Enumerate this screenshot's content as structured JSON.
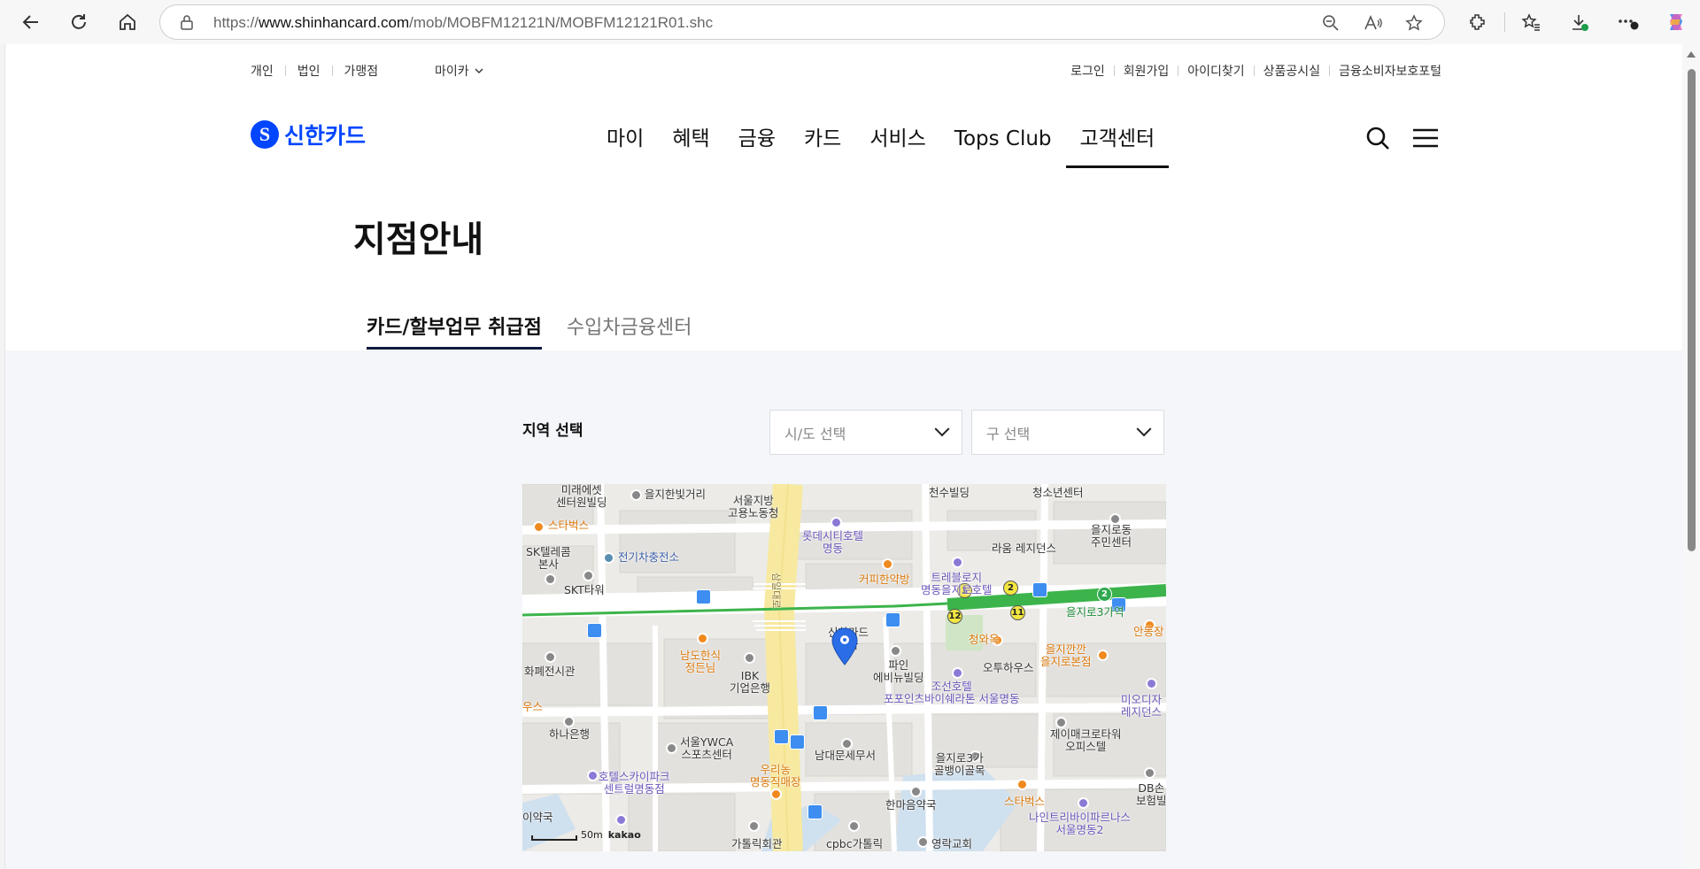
{
  "browser": {
    "url_prefix": "https://",
    "url_host": "www.shinhancard.com",
    "url_path": "/mob/MOBFM12121N/MOBFM12121R01.shc"
  },
  "util_nav": {
    "left": [
      "개인",
      "법인",
      "가맹점"
    ],
    "mycar": "마이카",
    "right": [
      "로그인",
      "회원가입",
      "아이디찾기",
      "상품공시실",
      "금융소비자보호포털"
    ]
  },
  "header": {
    "logo_mark": "S",
    "logo_text": "신한카드",
    "gnb": [
      "마이",
      "혜택",
      "금융",
      "카드",
      "서비스",
      "Tops Club",
      "고객센터"
    ]
  },
  "page": {
    "title": "지점안내",
    "tabs": [
      "카드/할부업무 취급점",
      "수입차금융센터"
    ]
  },
  "filter": {
    "label": "지역 선택",
    "city_placeholder": "시/도 선택",
    "district_placeholder": "구 선택"
  },
  "map": {
    "labels": {
      "l1": "미래에셋\n센터원빌딩",
      "l2": "을지한빛거리",
      "l3": "서울지방\n고용노동청",
      "l4": "천수빌딩",
      "l5": "청소년센터",
      "l6": "스타벅스",
      "l7": "롯데시티호텔\n명동",
      "l8": "을지로동\n주민센터",
      "l9": "SK텔레콤\n본사",
      "l10": "전기차충전소",
      "l11": "라움 레지던스",
      "l12": "커피한약방",
      "l13": "트레블로지\n명동을지로호텔",
      "l14": "SKT타워",
      "l15": "을지로3가역",
      "l16": "안동장",
      "l17": "남도한식\n정든님",
      "l18": "IBK\n기업은행",
      "l19": "신한카드\n본사",
      "l20": "파인\n에비뉴빌딩",
      "l21": "청와옥",
      "l22": "을지깐깐\n을지로본점",
      "l23": "화폐전시관",
      "l24": "오투하우스",
      "l25": "조선호텔\n포포인츠바이쉐라톤 서울명동",
      "l26": "미오디자\n레지던스",
      "l27": "하나은행",
      "l28": "서울YWCA\n스포츠센터",
      "l29": "남대문세무서",
      "l30": "제이매크로타워\n오피스텔",
      "l31": "을지로3가\n골뱅이골목",
      "l32": "호텔스카이파크\n센트럴명동점",
      "l33": "우리농\n명동직매장",
      "l34": "DB손\n보험빌",
      "l35": "한마음약국",
      "l36": "스타벅스",
      "l37": "나인트리바이파르나스\n서울명동2",
      "l38": "이약국",
      "l39": "가톨릭회관",
      "l40": "cpbc가톨릭",
      "l41": "영락교회",
      "road": "삼일대로",
      "u1": "우스"
    },
    "exits": [
      "1",
      "2",
      "12",
      "11"
    ],
    "line2": "2",
    "scale": "50m",
    "brand": "kakao"
  }
}
